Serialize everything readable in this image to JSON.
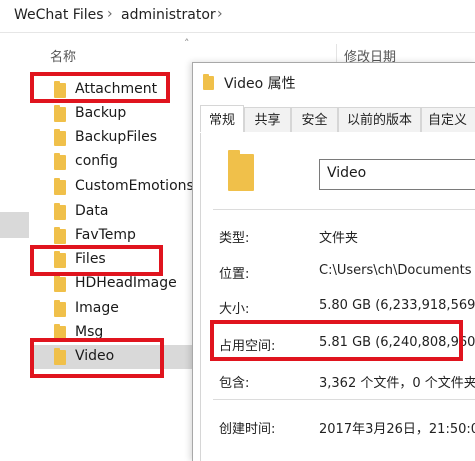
{
  "breadcrumb": {
    "path": [
      "WeChat Files",
      "administrator"
    ]
  },
  "columns": {
    "name": "名称",
    "modified": "修改日期"
  },
  "folders": [
    {
      "label": "Attachment",
      "highlighted": true
    },
    {
      "label": "Backup"
    },
    {
      "label": "BackupFiles"
    },
    {
      "label": "config"
    },
    {
      "label": "CustomEmotions"
    },
    {
      "label": "Data"
    },
    {
      "label": "FavTemp"
    },
    {
      "label": "Files",
      "highlighted": true
    },
    {
      "label": "HDHeadImage"
    },
    {
      "label": "Image"
    },
    {
      "label": "Msg"
    },
    {
      "label": "Video",
      "highlighted": true,
      "selected": true
    }
  ],
  "dialog": {
    "title": "Video 属性",
    "tabs": [
      "常规",
      "共享",
      "安全",
      "以前的版本",
      "自定义"
    ],
    "active_tab": "常规",
    "folder_name": "Video",
    "properties": [
      {
        "label": "类型:",
        "value": "文件夹"
      },
      {
        "label": "位置:",
        "value": "C:\\Users\\ch\\Documents"
      },
      {
        "label": "大小:",
        "value": "5.80 GB (6,233,918,569"
      },
      {
        "label": "占用空间:",
        "value": "5.81 GB (6,240,808,960",
        "highlighted": true
      },
      {
        "label": "包含:",
        "value": "3,362 个文件，0 个文件夹"
      },
      {
        "label": "创建时间:",
        "value": "2017年3月26日，21:50:0"
      }
    ]
  },
  "colors": {
    "highlight_box": "#e0141e",
    "folder": "#f0c04a",
    "selection": "#d9d9d9"
  }
}
